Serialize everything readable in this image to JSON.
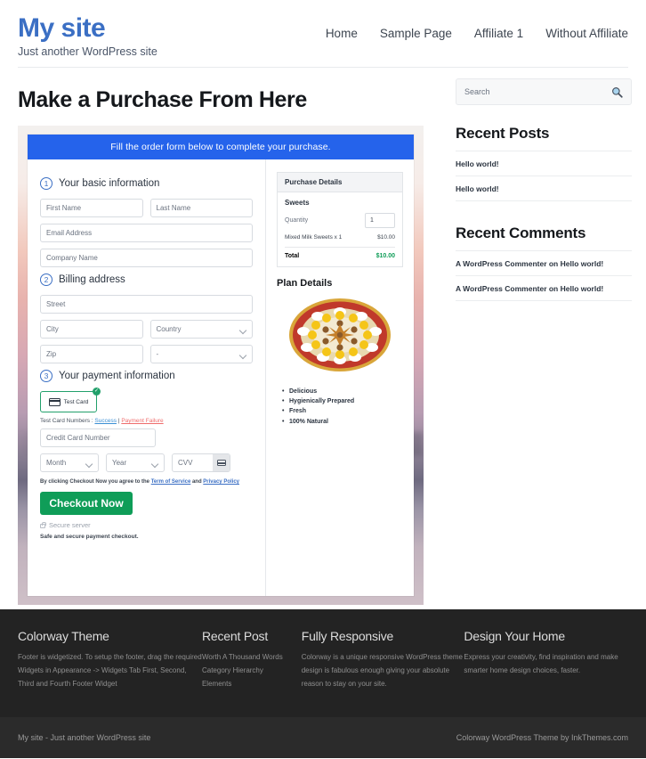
{
  "header": {
    "site_title": "My site",
    "tagline": "Just another WordPress site",
    "nav": [
      {
        "label": "Home"
      },
      {
        "label": "Sample Page"
      },
      {
        "label": "Affiliate 1"
      },
      {
        "label": "Without Affiliate"
      }
    ]
  },
  "main": {
    "page_title": "Make a Purchase From Here",
    "banner": "Fill the order form below to complete your purchase.",
    "steps": {
      "one_num": "1",
      "one_label": "Your basic information",
      "two_num": "2",
      "two_label": "Billing address",
      "three_num": "3",
      "three_label": "Your payment information"
    },
    "fields": {
      "first_name": "First Name",
      "last_name": "Last Name",
      "email": "Email Address",
      "company": "Company Name",
      "street": "Street",
      "city": "City",
      "country": "Country",
      "zip": "Zip",
      "state": "-",
      "credit_card": "Credit Card Number",
      "month": "Month",
      "year": "Year",
      "cvv": "CVV"
    },
    "payment": {
      "card_option_label": "Test  Card",
      "card_icon": "credit-card-icon",
      "selected_icon": "check-circle-icon",
      "testcard_prefix": "Test Card Numbers : ",
      "testcard_success": "Success",
      "testcard_sep": " | ",
      "testcard_failure": "Payment Failure",
      "terms_prefix": "By clicking Checkout Now you agree to the ",
      "terms_link1": "Term of Service",
      "terms_mid": " and ",
      "terms_link2": "Privacy Policy",
      "checkout_label": "Checkout Now",
      "secure_server": "Secure server",
      "safe_note": "Safe and secure payment checkout.",
      "lock_icon": "lock-icon"
    },
    "purchase_details": {
      "heading": "Purchase Details",
      "product": "Sweets",
      "quantity_label": "Quantity",
      "quantity_value": "1",
      "item_label": "Mixed Milk Sweets x 1",
      "item_price": "$10.00",
      "total_label": "Total",
      "total_value": "$10.00"
    },
    "plan": {
      "title": "Plan Details",
      "image_alt": "mixed-milk-sweets-platter",
      "features": [
        "Delicious",
        "Hygienically Prepared",
        "Fresh",
        "100% Natural"
      ]
    }
  },
  "sidebar": {
    "search_placeholder": "Search",
    "search_icon": "search-icon",
    "recent_posts": {
      "title": "Recent Posts",
      "items": [
        {
          "label": "Hello world!"
        },
        {
          "label": "Hello world!"
        }
      ]
    },
    "recent_comments": {
      "title": "Recent Comments",
      "items": [
        {
          "label": "A WordPress Commenter on Hello world!"
        },
        {
          "label": "A WordPress Commenter on Hello world!"
        }
      ]
    }
  },
  "footer": {
    "col1": {
      "title": "Colorway Theme",
      "text": "Footer is widgetized. To setup the footer, drag the required Widgets in Appearance -> Widgets Tab First, Second, Third and Fourth Footer Widget"
    },
    "col2": {
      "title": "Recent Post",
      "items": [
        {
          "label": "Worth A Thousand Words"
        },
        {
          "label": "Category Hierarchy"
        },
        {
          "label": "Elements"
        }
      ]
    },
    "col3": {
      "title": "Fully Responsive",
      "text": "Colorway is a unique responsive WordPress theme design is fabulous enough giving your absolute reason to stay on your site."
    },
    "col4": {
      "title": "Design Your Home",
      "text": "Express your creativity, find inspiration and make smarter home design choices, faster."
    },
    "bottom_left": "My site - Just another WordPress site",
    "bottom_right": "Colorway WordPress Theme by InkThemes.com"
  },
  "colors": {
    "brand_blue": "#3b6fc4",
    "banner_blue": "#2563eb",
    "success_green": "#0f9d58",
    "footer_dark": "#232323"
  }
}
